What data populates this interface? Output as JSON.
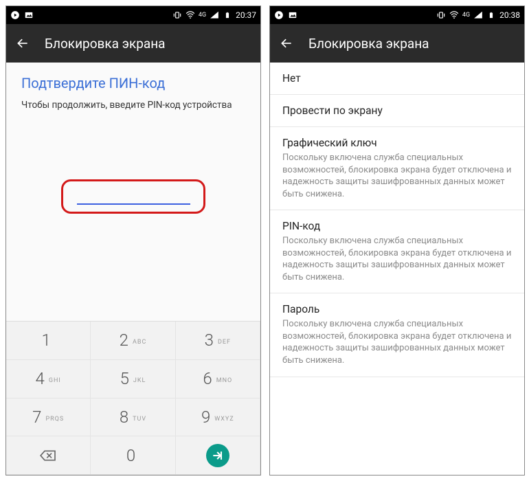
{
  "status": {
    "time_left": "20:37",
    "time_right": "20:38",
    "net": "4G"
  },
  "appbar": {
    "title": "Блокировка экрана"
  },
  "pin": {
    "header": "Подтвердите ПИН-код",
    "sub": "Чтобы продолжить, введите PIN-код устройства"
  },
  "keypad": {
    "k1": {
      "d": "1",
      "l": ""
    },
    "k2": {
      "d": "2",
      "l": "ABC"
    },
    "k3": {
      "d": "3",
      "l": "DEF"
    },
    "k4": {
      "d": "4",
      "l": "GHI"
    },
    "k5": {
      "d": "5",
      "l": "JKL"
    },
    "k6": {
      "d": "6",
      "l": "MNO"
    },
    "k7": {
      "d": "7",
      "l": "PRQS"
    },
    "k8": {
      "d": "8",
      "l": "TUV"
    },
    "k9": {
      "d": "9",
      "l": "WXYZ"
    },
    "k0": {
      "d": "0",
      "l": ""
    }
  },
  "options": {
    "none": {
      "title": "Нет"
    },
    "swipe": {
      "title": "Провести по экрану"
    },
    "pattern": {
      "title": "Графический ключ",
      "desc": "Поскольку включена служба специальных возможностей, блокировка экрана будет отключена и надежность защиты зашифрованных данных может быть снижена."
    },
    "pin": {
      "title": "PIN-код",
      "desc": "Поскольку включена служба специальных возможностей, блокировка экрана будет отключена и надежность защиты зашифрованных данных может быть снижена."
    },
    "password": {
      "title": "Пароль",
      "desc": "Поскольку включена служба специальных возможностей, блокировка экрана будет отключена и надежность защиты зашифрованных данных может быть снижена."
    }
  }
}
